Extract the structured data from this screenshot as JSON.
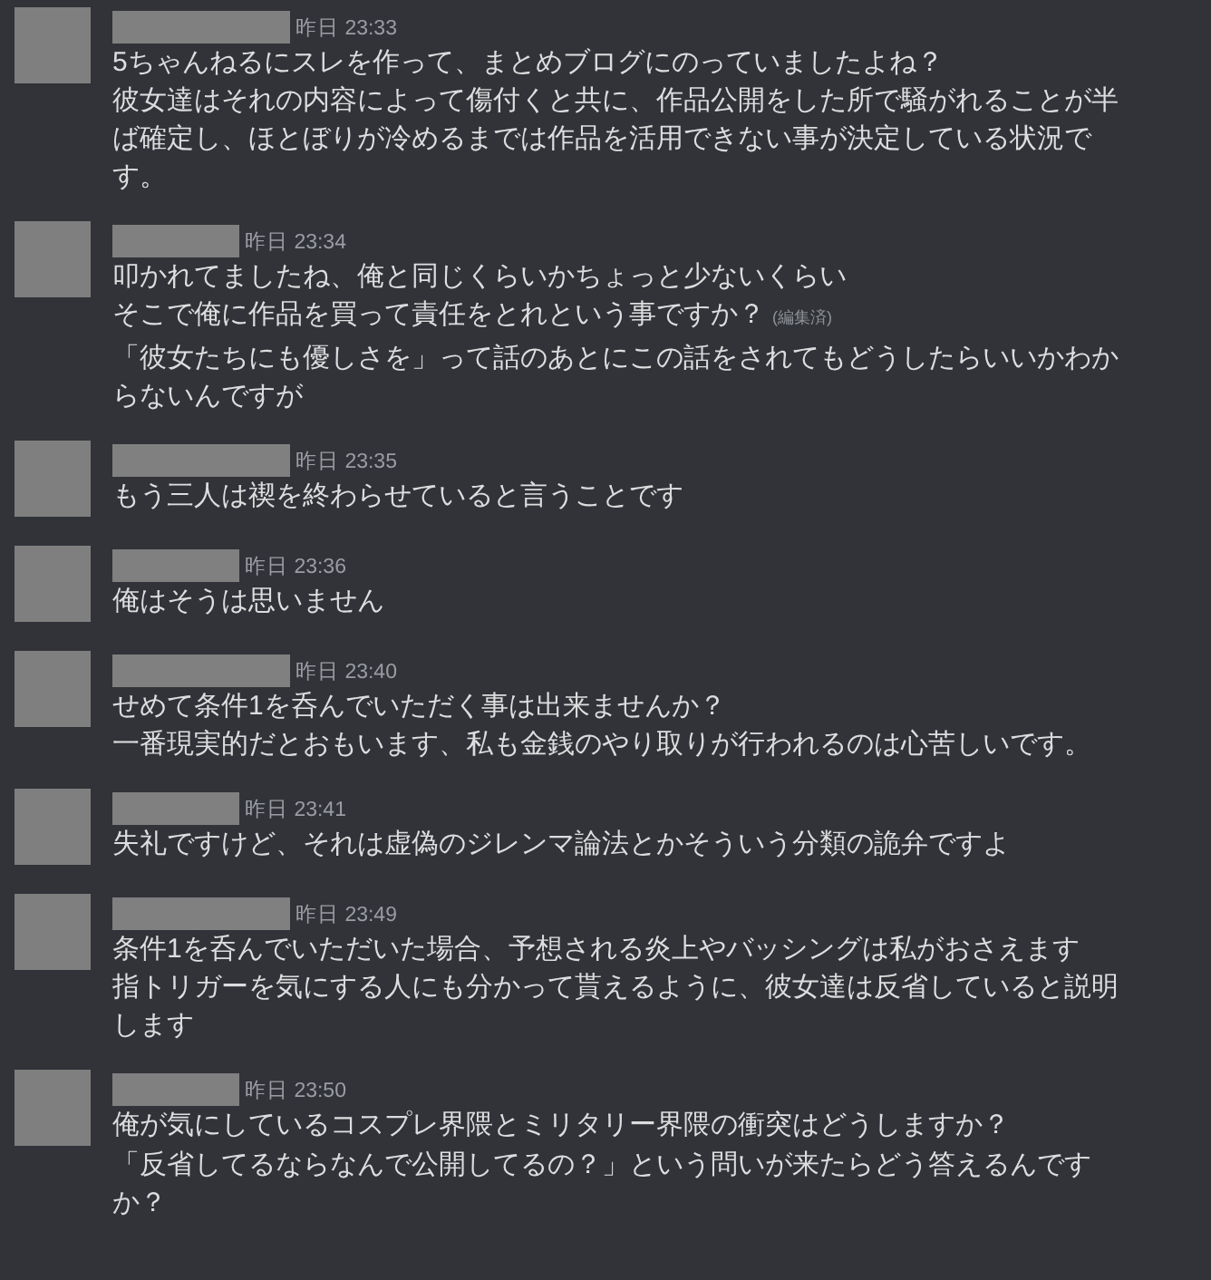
{
  "messages": [
    {
      "timestamp": "昨日 23:33",
      "paragraphs": [
        {
          "lines": [
            "5ちゃんねるにスレを作って、まとめブログにのっていましたよね？",
            "彼女達はそれの内容によって傷付くと共に、作品公開をした所で騒がれることが半ば確定し、ほとぼりが冷めるまでは作品を活用できない事が決定している状況です。"
          ]
        }
      ]
    },
    {
      "timestamp": "昨日 23:34",
      "paragraphs": [
        {
          "lines": [
            "叩かれてましたね、俺と同じくらいかちょっと少ないくらい",
            "そこで俺に作品を買って責任をとれという事ですか？"
          ],
          "edited": "(編集済)"
        },
        {
          "lines": [
            "「彼女たちにも優しさを」って話のあとにこの話をされてもどうしたらいいかわからないんですが"
          ]
        }
      ]
    },
    {
      "timestamp": "昨日 23:35",
      "paragraphs": [
        {
          "lines": [
            "もう三人は禊を終わらせていると言うことです"
          ]
        }
      ]
    },
    {
      "timestamp": "昨日 23:36",
      "paragraphs": [
        {
          "lines": [
            "俺はそうは思いません"
          ]
        }
      ]
    },
    {
      "timestamp": "昨日 23:40",
      "paragraphs": [
        {
          "lines": [
            "せめて条件1を呑んでいただく事は出来ませんか？",
            "一番現実的だとおもいます、私も金銭のやり取りが行われるのは心苦しいです。"
          ]
        }
      ]
    },
    {
      "timestamp": "昨日 23:41",
      "paragraphs": [
        {
          "lines": [
            "失礼ですけど、それは虚偽のジレンマ論法とかそういう分類の詭弁ですよ"
          ]
        }
      ]
    },
    {
      "timestamp": "昨日 23:49",
      "paragraphs": [
        {
          "lines": [
            "条件1を呑んでいただいた場合、予想される炎上やバッシングは私がおさえます",
            "指トリガーを気にする人にも分かって貰えるように、彼女達は反省していると説明します"
          ]
        }
      ]
    },
    {
      "timestamp": "昨日 23:50",
      "paragraphs": [
        {
          "lines": [
            "俺が気にしているコスプレ界隈とミリタリー界隈の衝突はどうしますか？"
          ]
        },
        {
          "lines": [
            "「反省してるならなんで公開してるの？」という問いが来たらどう答えるんですか？"
          ]
        }
      ]
    }
  ]
}
